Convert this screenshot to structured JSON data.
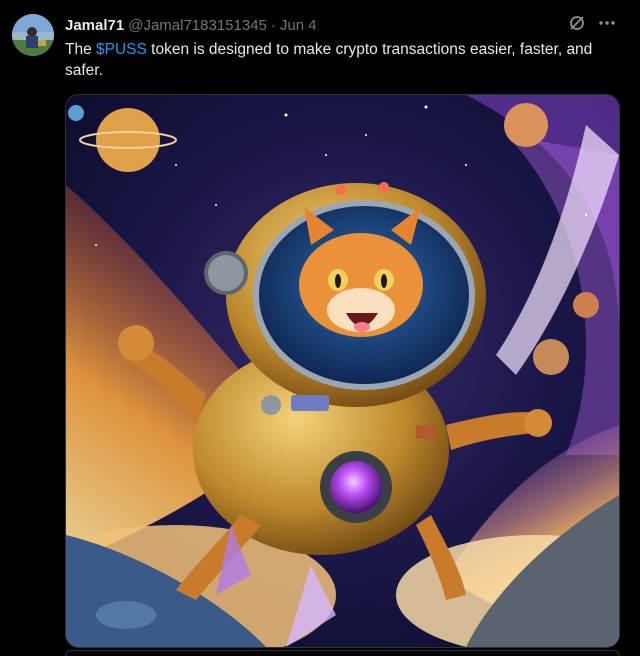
{
  "tweet": {
    "display_name": "Jamal71",
    "handle": "@Jamal7183151345",
    "separator": "·",
    "date": "Jun 4",
    "text_before": "The ",
    "cashtag": "$PUSS",
    "text_after": " token is designed to make crypto transactions easier, faster, and safer."
  },
  "icons": {
    "grok": "grok-icon",
    "more": "more-icon"
  },
  "media": {
    "description_icon": "image-media"
  },
  "colors": {
    "background": "#000000",
    "text": "#e7e9ea",
    "muted": "#71767b",
    "link": "#1d9bf0"
  }
}
